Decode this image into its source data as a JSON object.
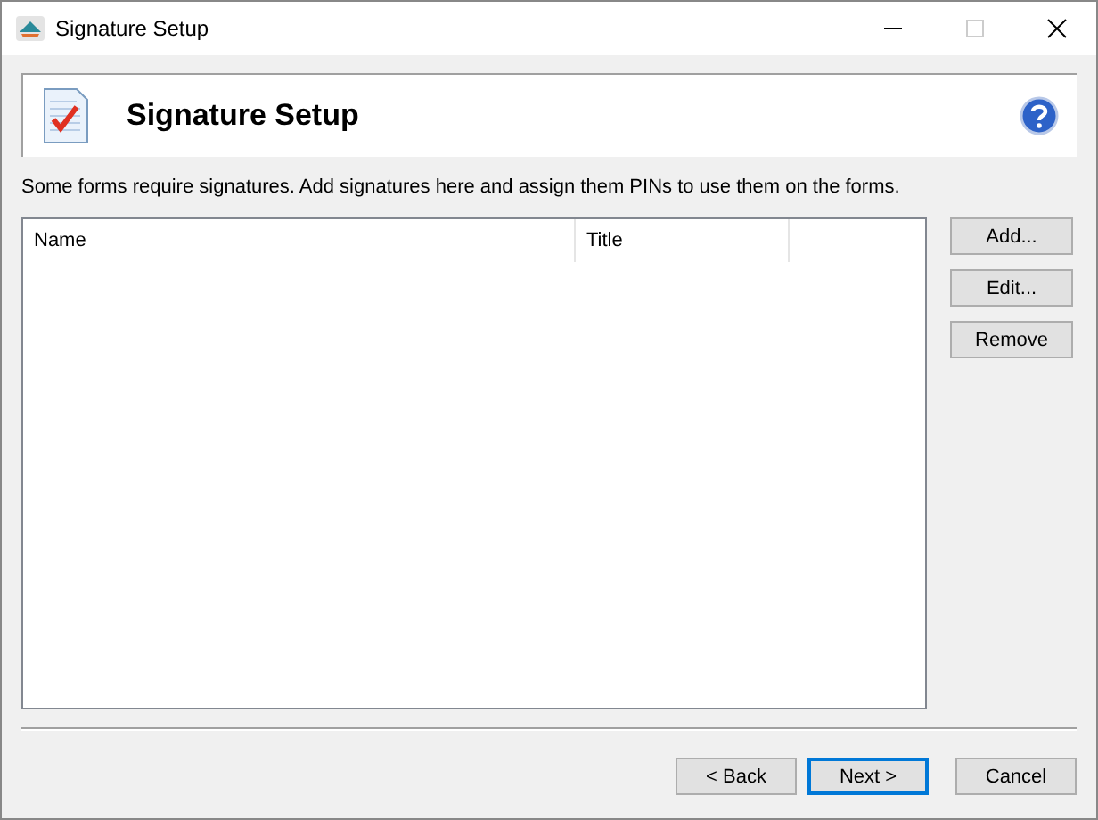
{
  "window": {
    "title": "Signature Setup"
  },
  "header": {
    "title": "Signature Setup"
  },
  "description": "Some forms require signatures. Add signatures here and assign them PINs to use them on the forms.",
  "table": {
    "columns": [
      "Name",
      "Title"
    ]
  },
  "side_buttons": [
    "Add...",
    "Edit...",
    "Remove"
  ],
  "footer_buttons": [
    {
      "label": "< Back",
      "default": false
    },
    {
      "label": "Next >",
      "default": true
    },
    {
      "label": "Cancel",
      "default": false
    }
  ]
}
